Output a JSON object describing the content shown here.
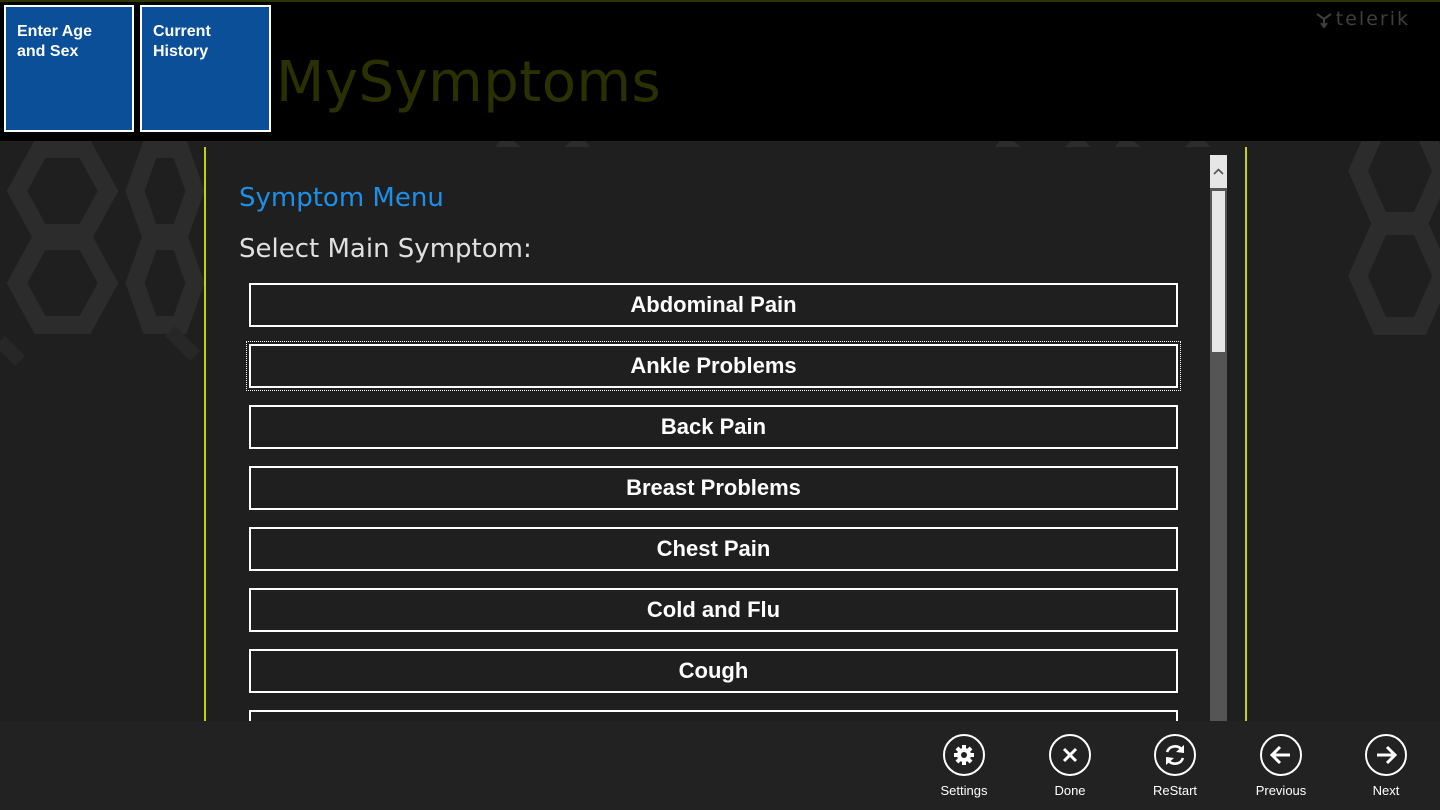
{
  "header": {
    "app_title": "MySymptoms",
    "brand": "telerik",
    "tiles": [
      {
        "label": "Enter Age and Sex"
      },
      {
        "label": "Current History"
      }
    ]
  },
  "main": {
    "title": "Symptom Menu",
    "subtitle": "Select Main Symptom:",
    "symptoms": [
      "Abdominal Pain",
      "Ankle Problems",
      "Back Pain",
      "Breast Problems",
      "Chest Pain",
      "Cold and Flu",
      "Cough",
      ""
    ],
    "focused_item": "Ankle Problems"
  },
  "appbar": {
    "commands": [
      {
        "label": "Settings",
        "icon": "gear-icon"
      },
      {
        "label": "Done",
        "icon": "close-icon"
      },
      {
        "label": "ReStart",
        "icon": "refresh-icon"
      },
      {
        "label": "Previous",
        "icon": "arrow-left-icon"
      },
      {
        "label": "Next",
        "icon": "arrow-right-icon"
      }
    ]
  },
  "colors": {
    "accent_blue": "#1e8fe8",
    "tile_blue": "#0b4f99",
    "panel_border": "#c3d400",
    "background": "#1f1f1f"
  }
}
